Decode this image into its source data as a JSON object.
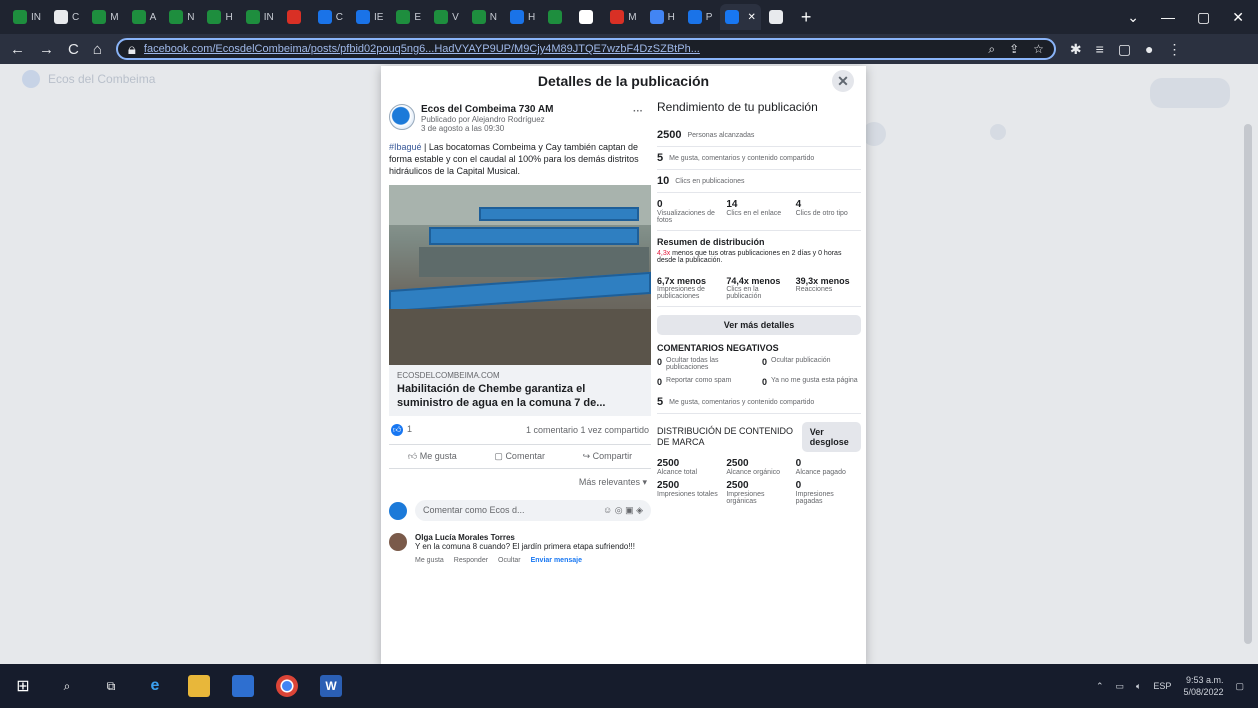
{
  "browser": {
    "tabs": [
      {
        "label": "IN",
        "color": "#1e8e3e"
      },
      {
        "label": "C",
        "color": "#e8eaed"
      },
      {
        "label": "M",
        "color": "#1e8e3e"
      },
      {
        "label": "A",
        "color": "#1e8e3e"
      },
      {
        "label": "N",
        "color": "#1e8e3e"
      },
      {
        "label": "H",
        "color": "#1e8e3e"
      },
      {
        "label": "IN",
        "color": "#1e8e3e"
      },
      {
        "label": "",
        "color": "#d93025"
      },
      {
        "label": "C",
        "color": "#1a73e8"
      },
      {
        "label": "IE",
        "color": "#1a73e8"
      },
      {
        "label": "E",
        "color": "#1e8e3e"
      },
      {
        "label": "V",
        "color": "#1e8e3e"
      },
      {
        "label": "N",
        "color": "#1e8e3e"
      },
      {
        "label": "H",
        "color": "#1a73e8"
      },
      {
        "label": "",
        "color": "#1e8e3e"
      },
      {
        "label": "",
        "color": "#ffffff"
      },
      {
        "label": "M",
        "color": "#d93025"
      },
      {
        "label": "H",
        "color": "#4285f4"
      },
      {
        "label": "P",
        "color": "#1a73e8"
      },
      {
        "label": "",
        "color": "#1877f2",
        "active": true
      },
      {
        "label": "",
        "color": "#e8eaed"
      }
    ],
    "url": "facebook.com/EcosdelCombeima/posts/pfbid02pouq5ng6...HadVYAYP9UP/M9Cjy4M89JTQE7wzbF4DzSZBtPh..."
  },
  "background": {
    "ghost_label": "Ecos del Combeima"
  },
  "modal": {
    "title": "Detalles de la publicación",
    "post": {
      "page_name": "Ecos del Combeima 730 AM",
      "published_by": "Publicado por Alejandro Rodríguez",
      "date": "3 de agosto a las 09:30",
      "hashtag": "#Ibagué",
      "text": " | Las bocatomas Combeima y Cay también captan de forma estable y con el caudal al 100% para los demás distritos hidráulicos de la Capital Musical.",
      "link_domain": "ECOSDELCOMBEIMA.COM",
      "link_title": "Habilitación de Chembe garantiza el suministro de agua en la comuna 7 de...",
      "reactions": "1",
      "comments_shares": "1 comentario  1 vez compartido",
      "actions": [
        "Me gusta",
        "Comentar",
        "Compartir"
      ],
      "sort": "Más relevantes",
      "comment_placeholder": "Comentar como Ecos d...",
      "comment": {
        "author": "Olga Lucía Morales Torres",
        "text": "Y en la comuna 8 cuando? El jardín primera etapa sufriendo!!!",
        "actions": [
          "Me gusta",
          "Responder",
          "Ocultar",
          "Enviar mensaje"
        ]
      }
    },
    "performance": {
      "title": "Rendimiento de tu publicación",
      "reach_value": "2500",
      "reach_label": "Personas alcanzadas",
      "interactions_value": "5",
      "interactions_label": "Me gusta, comentarios y contenido compartido",
      "clicks_value": "10",
      "clicks_label": "Clics en publicaciones",
      "grid": [
        {
          "value": "0",
          "label": "Visualizaciones de fotos"
        },
        {
          "value": "14",
          "label": "Clics en el enlace"
        },
        {
          "value": "4",
          "label": "Clics de otro tipo"
        }
      ],
      "summary_title": "Resumen de distribución",
      "summary_red": "4,3x",
      "summary_text": " menos que tus otras publicaciones en 2 días y 0 horas desde la publicación.",
      "compare": [
        {
          "value": "6,7x menos",
          "label": "Impresiones de publicaciones"
        },
        {
          "value": "74,4x menos",
          "label": "Clics en la publicación"
        },
        {
          "value": "39,3x menos",
          "label": "Reacciones"
        }
      ],
      "more_button": "Ver más detalles",
      "neg_title": "COMENTARIOS NEGATIVOS",
      "neg": [
        {
          "value": "0",
          "label": "Ocultar todas las publicaciones"
        },
        {
          "value": "0",
          "label": "Ocultar publicación"
        },
        {
          "value": "0",
          "label": "Reportar como spam"
        },
        {
          "value": "0",
          "label": "Ya no me gusta esta página"
        }
      ],
      "neg_interactions_value": "5",
      "neg_interactions_label": "Me gusta, comentarios y contenido compartido",
      "brand_title": "DISTRIBUCIÓN DE CONTENIDO DE MARCA",
      "brand_button": "Ver desglose",
      "brand_grid": [
        {
          "value": "2500",
          "label": "Alcance total"
        },
        {
          "value": "2500",
          "label": "Alcance orgánico"
        },
        {
          "value": "0",
          "label": "Alcance pagado"
        },
        {
          "value": "2500",
          "label": "Impresiones totales"
        },
        {
          "value": "2500",
          "label": "Impresiones orgánicas"
        },
        {
          "value": "0",
          "label": "Impresiones pagadas"
        }
      ]
    }
  },
  "taskbar": {
    "language": "ESP",
    "time": "9:53 a.m.",
    "date": "5/08/2022"
  }
}
